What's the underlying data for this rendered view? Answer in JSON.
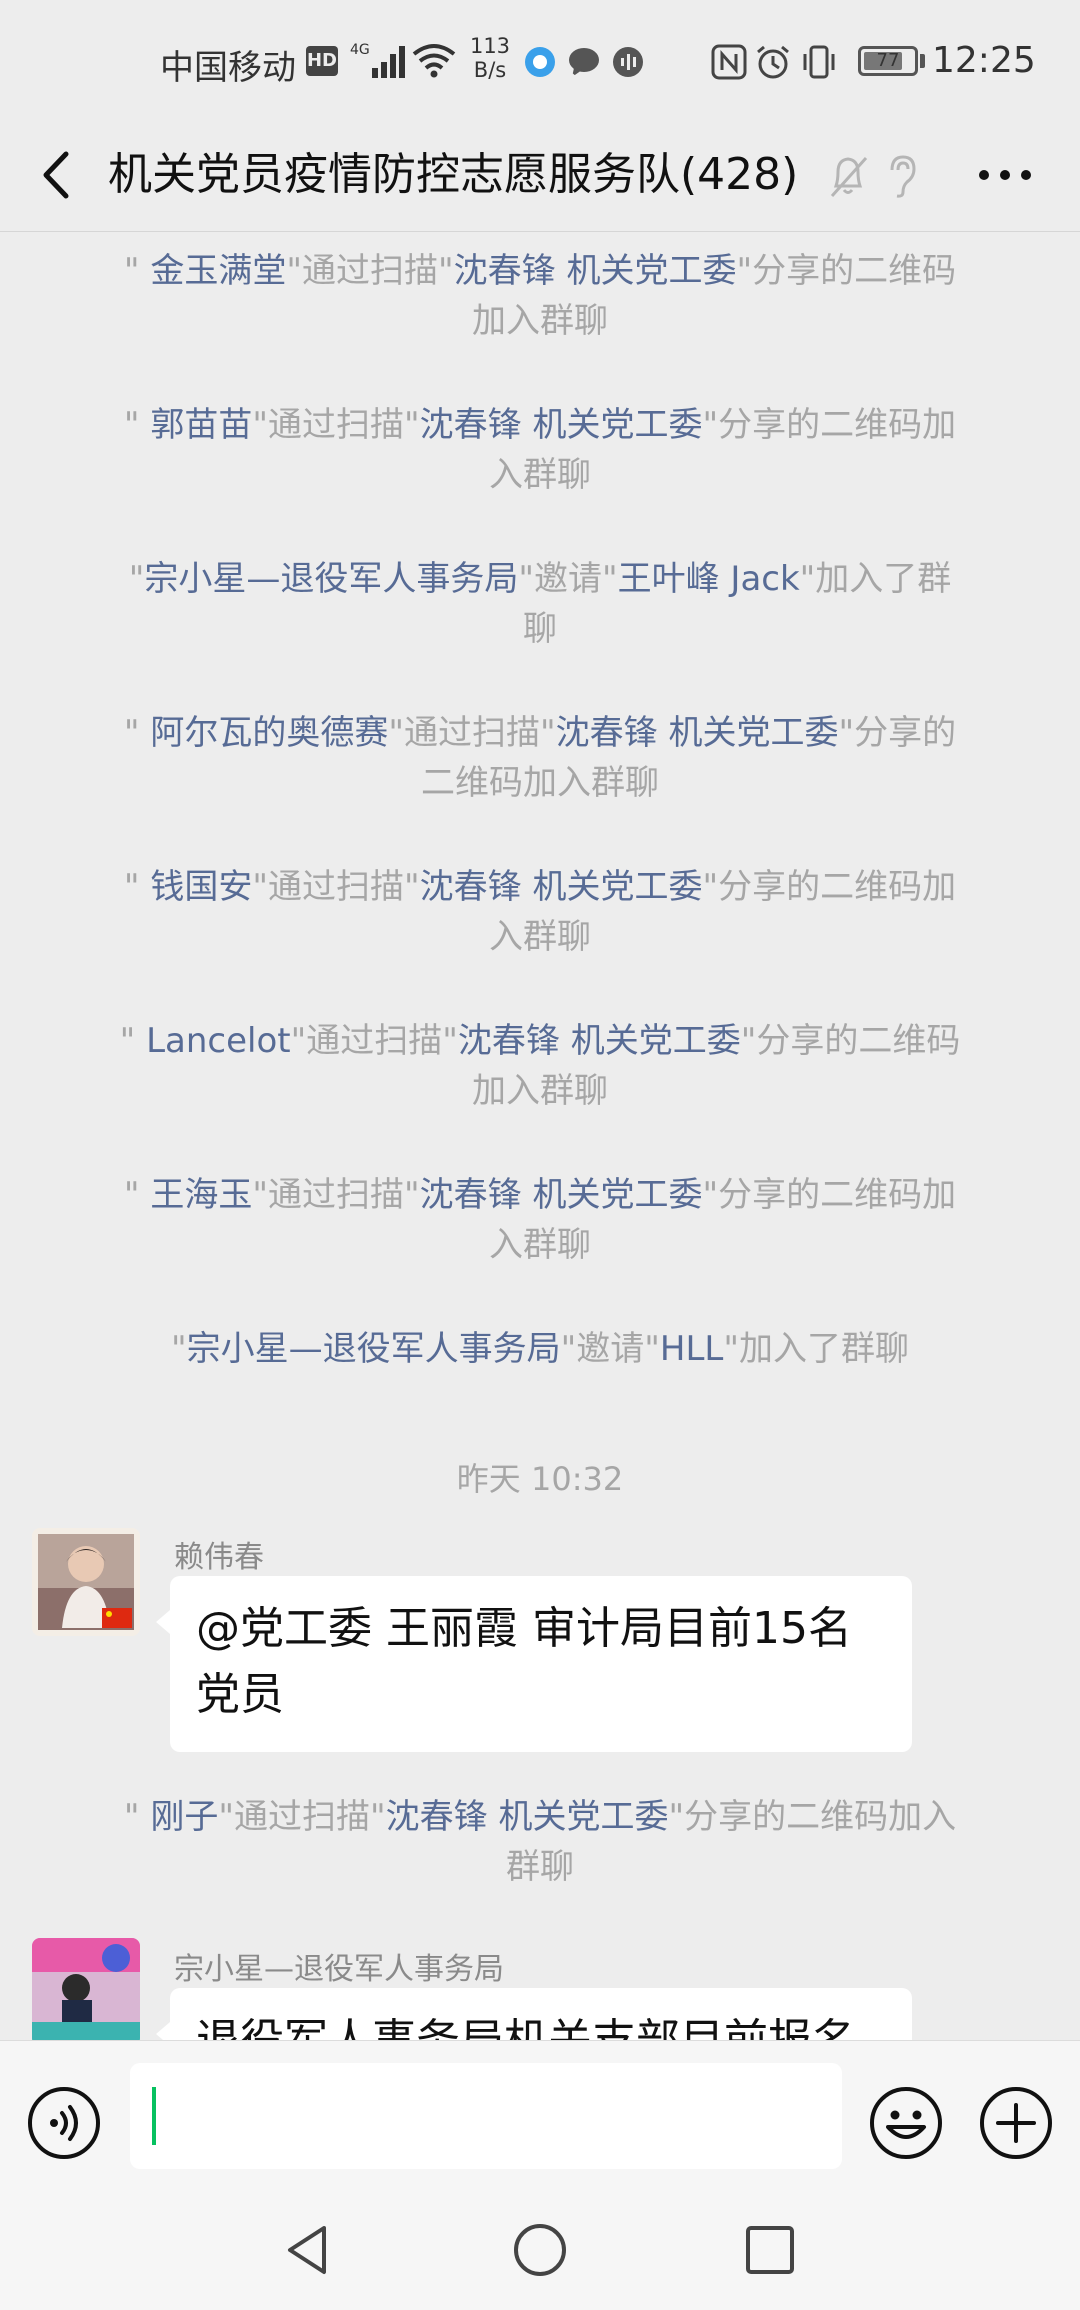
{
  "status_bar": {
    "carrier": "中国移动",
    "hd_badge": "HD",
    "network_speed_value": "113",
    "network_speed_unit": "B/s",
    "battery": "77",
    "time": "12:25",
    "icons": [
      "hd-icon",
      "signal-4g-icon",
      "wifi-icon",
      "browser-app-icon",
      "message-app-icon",
      "voice-app-icon",
      "nfc-icon",
      "alarm-icon",
      "vibrate-icon",
      "battery-icon"
    ]
  },
  "header": {
    "title": "机关党员疫情防控志愿服务队(428)",
    "icons": [
      "back-icon",
      "mute-icon",
      "ear-icon",
      "more-icon"
    ]
  },
  "messages": [
    {
      "type": "system",
      "parts": [
        {
          "t": "\" ",
          "hl": false
        },
        {
          "t": "金玉满堂",
          "hl": true
        },
        {
          "t": "\"通过扫描\"",
          "hl": false
        },
        {
          "t": "沈春锋 机关党工委",
          "hl": true
        },
        {
          "t": "\"分享的二维码",
          "hl": false
        }
      ],
      "line2": "加入群聊"
    },
    {
      "type": "system",
      "parts": [
        {
          "t": "\" ",
          "hl": false
        },
        {
          "t": "郭苗苗",
          "hl": true
        },
        {
          "t": "\"通过扫描\"",
          "hl": false
        },
        {
          "t": "沈春锋 机关党工委",
          "hl": true
        },
        {
          "t": "\"分享的二维码加",
          "hl": false
        }
      ],
      "line2": "入群聊"
    },
    {
      "type": "system",
      "parts": [
        {
          "t": "\"",
          "hl": false
        },
        {
          "t": "宗小星—退役军人事务局",
          "hl": true
        },
        {
          "t": "\"邀请\"",
          "hl": false
        },
        {
          "t": "王叶峰 Jack",
          "hl": true
        },
        {
          "t": "\"加入了群",
          "hl": false
        }
      ],
      "line2": "聊"
    },
    {
      "type": "system",
      "parts": [
        {
          "t": "\" ",
          "hl": false
        },
        {
          "t": "阿尔瓦的奥德赛",
          "hl": true
        },
        {
          "t": "\"通过扫描\"",
          "hl": false
        },
        {
          "t": "沈春锋 机关党工委",
          "hl": true
        },
        {
          "t": "\"分享的",
          "hl": false
        }
      ],
      "line2": "二维码加入群聊"
    },
    {
      "type": "system",
      "parts": [
        {
          "t": "\" ",
          "hl": false
        },
        {
          "t": "钱国安",
          "hl": true
        },
        {
          "t": "\"通过扫描\"",
          "hl": false
        },
        {
          "t": "沈春锋 机关党工委",
          "hl": true
        },
        {
          "t": "\"分享的二维码加",
          "hl": false
        }
      ],
      "line2": "入群聊"
    },
    {
      "type": "system",
      "parts": [
        {
          "t": "\" ",
          "hl": false
        },
        {
          "t": "Lancelot",
          "hl": true
        },
        {
          "t": "\"通过扫描\"",
          "hl": false
        },
        {
          "t": "沈春锋 机关党工委",
          "hl": true
        },
        {
          "t": "\"分享的二维码",
          "hl": false
        }
      ],
      "line2": "加入群聊"
    },
    {
      "type": "system",
      "parts": [
        {
          "t": "\" ",
          "hl": false
        },
        {
          "t": "王海玉",
          "hl": true
        },
        {
          "t": "\"通过扫描\"",
          "hl": false
        },
        {
          "t": "沈春锋 机关党工委",
          "hl": true
        },
        {
          "t": "\"分享的二维码加",
          "hl": false
        }
      ],
      "line2": "入群聊"
    },
    {
      "type": "system",
      "parts": [
        {
          "t": "\"",
          "hl": false
        },
        {
          "t": "宗小星—退役军人事务局",
          "hl": true
        },
        {
          "t": "\"邀请\"",
          "hl": false
        },
        {
          "t": "HLL",
          "hl": true
        },
        {
          "t": "\"加入了群聊",
          "hl": false
        }
      ],
      "line2": ""
    }
  ],
  "timestamp": "昨天 10:32",
  "chat_message_1": {
    "sender": "赖伟春",
    "line1": "@党工委 王丽霞  审计局目前15名",
    "line2": "党员"
  },
  "system_after": {
    "parts": [
      {
        "t": "\" ",
        "hl": false
      },
      {
        "t": "刚子",
        "hl": true
      },
      {
        "t": "\"通过扫描\"",
        "hl": false
      },
      {
        "t": "沈春锋 机关党工委",
        "hl": true
      },
      {
        "t": "\"分享的二维码加入",
        "hl": false
      }
    ],
    "line2": "群聊"
  },
  "chat_message_2": {
    "sender": "宗小星—退役军人事务局",
    "line1": "退役军人事务局机关支部目前报名"
  },
  "input_bar": {
    "placeholder": "",
    "icons": [
      "voice-icon",
      "emoji-icon",
      "plus-icon"
    ]
  },
  "nav_bar": {
    "icons": [
      "nav-back-icon",
      "nav-home-icon",
      "nav-recent-icon"
    ]
  },
  "colors": {
    "background": "#ededed",
    "link": "#576b95",
    "system_text": "#a6a6a6",
    "caret": "#07c160"
  }
}
